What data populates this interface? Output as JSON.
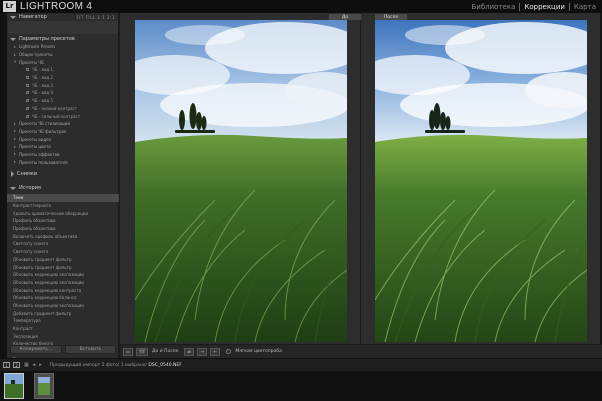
{
  "app": {
    "logo": "Lr",
    "title": "LIGHTROOM 4",
    "modules": [
      "Библиотека",
      "Коррекции",
      "Карта"
    ],
    "active_module": "Коррекции"
  },
  "left_panel": {
    "navigator": {
      "title": "Навигатор",
      "options": "FIT FILL 1:1 2:1"
    },
    "presets": {
      "title": "Параметры пресетов",
      "rows": [
        {
          "label": "Lightroom Presets",
          "level": 1,
          "open": false
        },
        {
          "label": "Общие пресеты",
          "level": 1,
          "open": false
        },
        {
          "label": "Пресеты ЧБ",
          "level": 1,
          "open": true
        },
        {
          "label": "ЧБ - вид 1",
          "level": 2
        },
        {
          "label": "ЧБ - вид 2",
          "level": 2
        },
        {
          "label": "ЧБ - вид 3",
          "level": 2
        },
        {
          "label": "ЧБ - вид 4",
          "level": 2
        },
        {
          "label": "ЧБ - вид 5",
          "level": 2
        },
        {
          "label": "ЧБ - низкий контраст",
          "level": 2
        },
        {
          "label": "ЧБ - сильный контраст",
          "level": 2
        },
        {
          "label": "Пресеты ЧБ стилизаций",
          "level": 1,
          "open": false
        },
        {
          "label": "Пресеты ЧБ фильтров",
          "level": 1,
          "open": false
        },
        {
          "label": "Пресеты видео",
          "level": 1,
          "open": false
        },
        {
          "label": "Пресеты цвета",
          "level": 1,
          "open": false
        },
        {
          "label": "Пресеты эффектов",
          "level": 1,
          "open": false
        },
        {
          "label": "Пресеты пользователя",
          "level": 1,
          "open": false
        }
      ]
    },
    "snapshots": {
      "title": "Снимки"
    },
    "history": {
      "title": "История",
      "items": [
        {
          "label": "Тени",
          "value": "",
          "active": true
        },
        {
          "label": "Контраст/черного",
          "value": ""
        },
        {
          "label": "Удалить хроматические аберрации",
          "value": ""
        },
        {
          "label": "Профиль объектива",
          "value": ""
        },
        {
          "label": "Профиль объектива",
          "value": ""
        },
        {
          "label": "Включить профиль объектива",
          "value": ""
        },
        {
          "label": "Светлоту синего",
          "value": ""
        },
        {
          "label": "Светлоту синего",
          "value": ""
        },
        {
          "label": "Обновить градиент фильтр",
          "value": ""
        },
        {
          "label": "Обновить градиент фильтр",
          "value": ""
        },
        {
          "label": "Обновить коррекцию экспозиции",
          "value": ""
        },
        {
          "label": "Обновить коррекцию экспозиции",
          "value": ""
        },
        {
          "label": "Обновить коррекцию контраста",
          "value": ""
        },
        {
          "label": "Обновить коррекцию баланса",
          "value": ""
        },
        {
          "label": "Обновить коррекцию экспозиции",
          "value": ""
        },
        {
          "label": "Добавить градиент фильтр",
          "value": ""
        },
        {
          "label": "Температура",
          "value": ""
        },
        {
          "label": "Контраст",
          "value": ""
        },
        {
          "label": "Экспозиция",
          "value": ""
        },
        {
          "label": "Количество белого",
          "value": ""
        },
        {
          "label": "Тени",
          "value": ""
        },
        {
          "label": "Тени",
          "value": ""
        }
      ]
    },
    "copy_label": "Копировать...",
    "paste_label": "Вставить"
  },
  "main": {
    "before_label": "До",
    "after_label": "После"
  },
  "toolbar": {
    "view_label": "Y|Y",
    "mode_label": "До и После",
    "soft_proof_label": "Мягкая цветопроба"
  },
  "filmstrip": {
    "status": "Предыдущий импорт  2 фото/ 1 выбрано/",
    "filename": "DSC_0540.NEF"
  }
}
